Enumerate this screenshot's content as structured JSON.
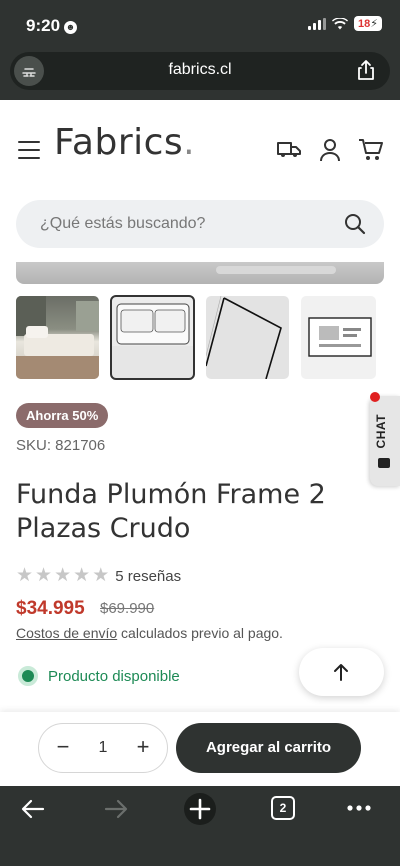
{
  "status_bar": {
    "time": "9:20",
    "battery": "18"
  },
  "browser": {
    "url": "fabrics.cl",
    "tab_count": "2"
  },
  "header": {
    "logo": "Fabrics",
    "logo_dot": "."
  },
  "search": {
    "placeholder": "¿Qué estás buscando?"
  },
  "product": {
    "badge": "Ahorra 50%",
    "sku": "SKU: 821706",
    "title": "Funda Plumón Frame 2 Plazas Crudo",
    "rating_stars": 5,
    "reviews": "5 reseñas",
    "price": "$34.995",
    "old_price": "$69.990",
    "shipping_link": "Costos de envío",
    "shipping_rest": " calculados previo al pago.",
    "availability": "Producto disponible"
  },
  "chat": {
    "label": "CHAT"
  },
  "cart": {
    "quantity": "1",
    "minus": "−",
    "plus": "+",
    "add_label": "Agregar al carrito"
  },
  "colors": {
    "dark": "#2f3331",
    "price_red": "#c0392b",
    "available_green": "#1d8a55",
    "badge": "#8b6b6b"
  }
}
